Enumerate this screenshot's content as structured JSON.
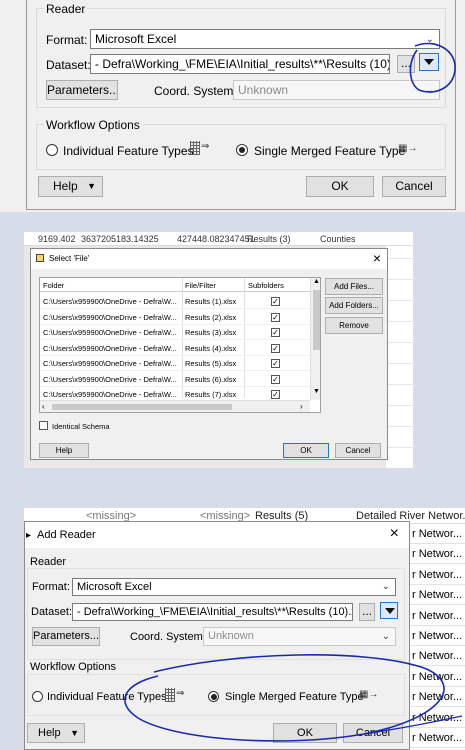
{
  "top_dialog": {
    "reader_group": "Reader",
    "format_label": "Format:",
    "format_value": "Microsoft Excel",
    "dataset_label": "Dataset:",
    "dataset_value": "- Defra\\Working_\\FME\\EIA\\Initial_results\\**\\Results (10).xlsx\"",
    "browse_label": "...",
    "parameters_label": "Parameters...",
    "coord_label": "Coord. System:",
    "coord_value": "Unknown",
    "workflow_group": "Workflow Options",
    "individual_label": "Individual Feature Types",
    "merged_label": "Single Merged Feature Type",
    "help_label": "Help",
    "ok_label": "OK",
    "cancel_label": "Cancel"
  },
  "middle": {
    "bg_row": [
      "9169.402",
      "3637205183.14325",
      "427448.082347451",
      "Results (3)",
      "Counties"
    ],
    "title": "Select 'File'",
    "col_folder": "Folder",
    "col_filter": "File/Filter",
    "col_subfolders": "Subfolders",
    "rows": [
      {
        "folder": "C:\\Users\\x959900\\OneDrive - Defra\\W...",
        "filter": "Results (1).xlsx"
      },
      {
        "folder": "C:\\Users\\x959900\\OneDrive - Defra\\W...",
        "filter": "Results (2).xlsx"
      },
      {
        "folder": "C:\\Users\\x959900\\OneDrive - Defra\\W...",
        "filter": "Results (3).xlsx"
      },
      {
        "folder": "C:\\Users\\x959900\\OneDrive - Defra\\W...",
        "filter": "Results (4).xlsx"
      },
      {
        "folder": "C:\\Users\\x959900\\OneDrive - Defra\\W...",
        "filter": "Results (5).xlsx"
      },
      {
        "folder": "C:\\Users\\x959900\\OneDrive - Defra\\W...",
        "filter": "Results (6).xlsx"
      },
      {
        "folder": "C:\\Users\\x959900\\OneDrive - Defra\\W...",
        "filter": "Results (7).xlsx"
      }
    ],
    "check_mark": "✓",
    "add_files": "Add Files...",
    "add_folders": "Add Folders...",
    "remove": "Remove",
    "identical_schema": "Identical Schema",
    "help_label": "Help",
    "ok_label": "OK",
    "cancel_label": "Cancel",
    "close_glyph": "×"
  },
  "bottom_dialog": {
    "bg_missing_1": "<missing>",
    "bg_missing_2": "<missing>",
    "bg_results": "Results (5)",
    "bg_detailed": "Detailed River Networ...",
    "right_col_text": "r Networ...",
    "title": "Add Reader",
    "close_glyph": "×",
    "reader_group": "Reader",
    "format_label": "Format:",
    "format_value": "Microsoft Excel",
    "dataset_label": "Dataset:",
    "dataset_value": "- Defra\\Working_\\FME\\EIA\\Initial_results\\**\\Results (10).xlsx\"",
    "browse_label": "...",
    "parameters_label": "Parameters...",
    "coord_label": "Coord. System:",
    "coord_value": "Unknown",
    "workflow_group": "Workflow Options",
    "individual_label": "Individual Feature Types",
    "merged_label": "Single Merged Feature Type",
    "help_label": "Help",
    "ok_label": "OK",
    "cancel_label": "Cancel"
  },
  "colors": {
    "annotation": "#1a2ab0",
    "accent": "#2b73c9"
  }
}
